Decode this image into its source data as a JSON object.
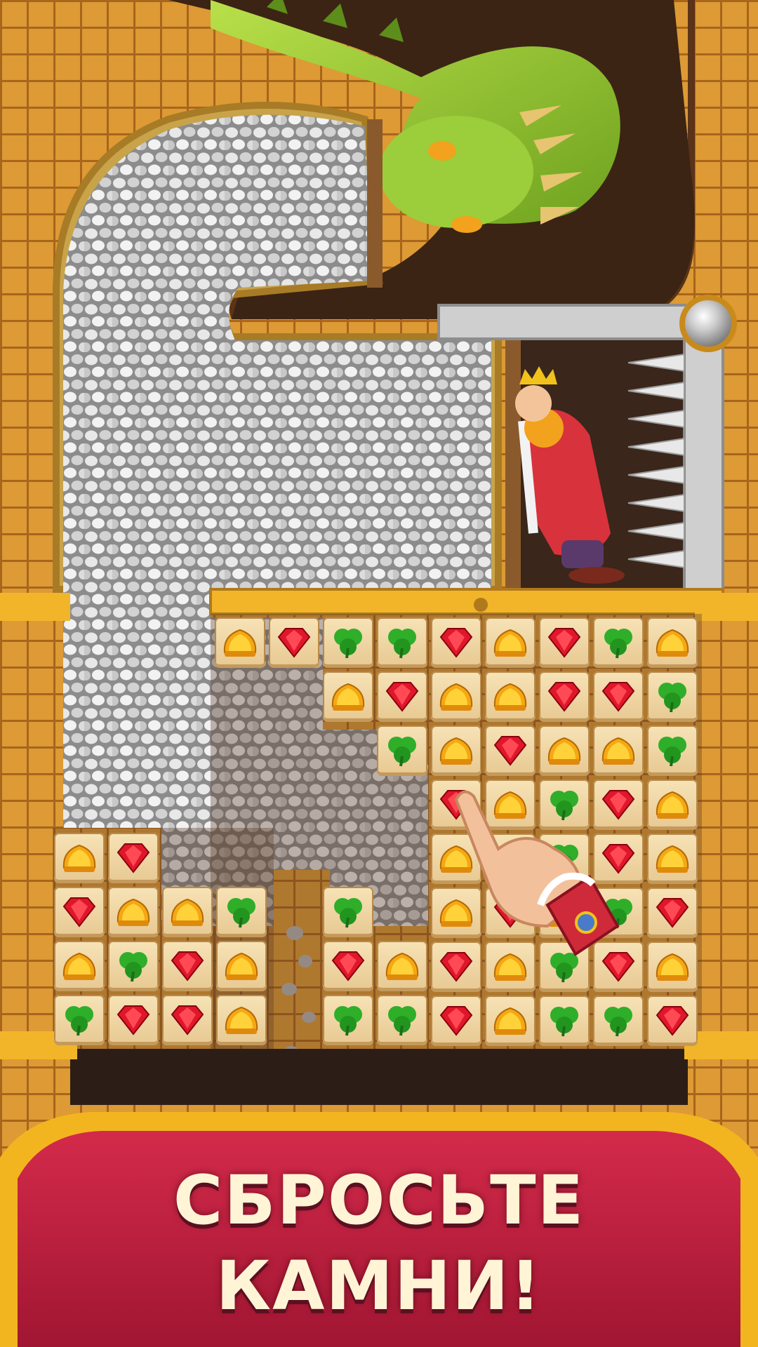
{
  "banner": {
    "line1": "СБРОСЬТЕ",
    "line2": "КАМНИ!"
  },
  "colors": {
    "banner_red": "#c01f3f",
    "banner_gold": "#f3b51f",
    "brick": "#dd9a35",
    "tile": "#f2d9a6"
  },
  "icons": {
    "gem_types": [
      "crown-icon",
      "ruby-icon",
      "clover-icon"
    ]
  },
  "board": {
    "rows": [
      [
        "crown",
        "ruby",
        "clover",
        "clover",
        "ruby",
        "crown",
        "ruby",
        "clover",
        "crown"
      ],
      [
        "",
        "",
        "crown",
        "ruby",
        "crown",
        "crown",
        "ruby",
        "ruby",
        "clover"
      ],
      [
        "",
        "",
        "",
        "clover",
        "crown",
        "ruby",
        "crown",
        "crown",
        "clover"
      ],
      [
        "",
        "",
        "",
        "",
        "ruby",
        "crown",
        "clover",
        "ruby",
        "crown"
      ],
      [
        "",
        "",
        "",
        "",
        "crown",
        "crown",
        "clover",
        "ruby",
        "crown"
      ],
      [
        "",
        "",
        "",
        "",
        "crown",
        "ruby",
        "crown",
        "clover",
        "ruby"
      ],
      [
        "",
        "",
        "",
        "",
        "ruby",
        "crown",
        "clover",
        "ruby",
        "crown"
      ],
      [
        "",
        "",
        "",
        "",
        "ruby",
        "crown",
        "clover",
        "clover",
        "ruby"
      ]
    ],
    "left_rows": [
      [
        "crown",
        "ruby",
        "",
        ""
      ],
      [
        "ruby",
        "crown",
        "crown",
        "clover"
      ],
      [
        "crown",
        "clover",
        "ruby",
        "crown"
      ],
      [
        "clover",
        "ruby",
        "ruby",
        "crown"
      ]
    ],
    "middle_rows": [
      [
        "clover",
        "",
        ""
      ],
      [
        "ruby",
        "crown",
        ""
      ],
      [
        "clover",
        "clover",
        ""
      ]
    ]
  }
}
